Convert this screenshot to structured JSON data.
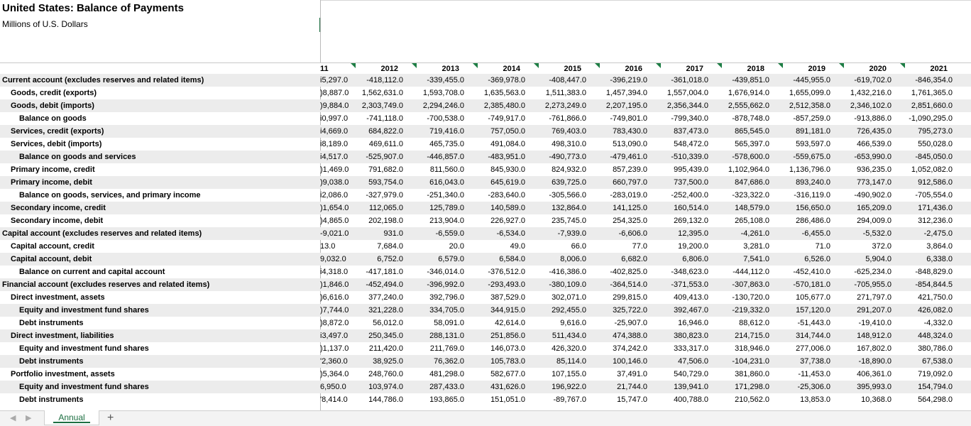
{
  "sheet": {
    "title": "United States: Balance of Payments",
    "subtitle": "Millions of U.S. Dollars"
  },
  "years": [
    {
      "label": "11",
      "partial": true
    },
    {
      "label": "2012"
    },
    {
      "label": "2013"
    },
    {
      "label": "2014"
    },
    {
      "label": "2015"
    },
    {
      "label": "2016"
    },
    {
      "label": "2017"
    },
    {
      "label": "2018"
    },
    {
      "label": "2019"
    },
    {
      "label": "2020"
    },
    {
      "label": "2021"
    }
  ],
  "rows": [
    {
      "label": "Current account (excludes reserves and related items)",
      "indent": 0,
      "values": [
        "i5,297.0",
        "-418,112.0",
        "-339,455.0",
        "-369,978.0",
        "-408,447.0",
        "-396,219.0",
        "-361,018.0",
        "-439,851.0",
        "-445,955.0",
        "-619,702.0",
        "-846,354.0"
      ]
    },
    {
      "label": "Goods, credit (exports)",
      "indent": 1,
      "values": [
        ")8,887.0",
        "1,562,631.0",
        "1,593,708.0",
        "1,635,563.0",
        "1,511,383.0",
        "1,457,394.0",
        "1,557,004.0",
        "1,676,914.0",
        "1,655,099.0",
        "1,432,216.0",
        "1,761,365.0"
      ]
    },
    {
      "label": "Goods, debit (imports)",
      "indent": 1,
      "values": [
        ")9,884.0",
        "2,303,749.0",
        "2,294,246.0",
        "2,385,480.0",
        "2,273,249.0",
        "2,207,195.0",
        "2,356,344.0",
        "2,555,662.0",
        "2,512,358.0",
        "2,346,102.0",
        "2,851,660.0"
      ]
    },
    {
      "label": "Balance on goods",
      "indent": 2,
      "values": [
        "i0,997.0",
        "-741,118.0",
        "-700,538.0",
        "-749,917.0",
        "-761,866.0",
        "-749,801.0",
        "-799,340.0",
        "-878,748.0",
        "-857,259.0",
        "-913,886.0",
        "-1,090,295.0"
      ]
    },
    {
      "label": "Services, credit (exports)",
      "indent": 1,
      "values": [
        "i4,669.0",
        "684,822.0",
        "719,416.0",
        "757,050.0",
        "769,403.0",
        "783,430.0",
        "837,473.0",
        "865,545.0",
        "891,181.0",
        "726,435.0",
        "795,273.0"
      ]
    },
    {
      "label": "Services, debit (imports)",
      "indent": 1,
      "values": [
        "i8,189.0",
        "469,611.0",
        "465,735.0",
        "491,084.0",
        "498,310.0",
        "513,090.0",
        "548,472.0",
        "565,397.0",
        "593,597.0",
        "466,539.0",
        "550,028.0"
      ]
    },
    {
      "label": "Balance on goods and services",
      "indent": 2,
      "values": [
        "i4,517.0",
        "-525,907.0",
        "-446,857.0",
        "-483,951.0",
        "-490,773.0",
        "-479,461.0",
        "-510,339.0",
        "-578,600.0",
        "-559,675.0",
        "-653,990.0",
        "-845,050.0"
      ]
    },
    {
      "label": "Primary income, credit",
      "indent": 1,
      "values": [
        ")1,469.0",
        "791,682.0",
        "811,560.0",
        "845,930.0",
        "824,932.0",
        "857,239.0",
        "995,439.0",
        "1,102,964.0",
        "1,136,796.0",
        "936,235.0",
        "1,052,082.0"
      ]
    },
    {
      "label": "Primary income, debit",
      "indent": 1,
      "values": [
        ")9,038.0",
        "593,754.0",
        "616,043.0",
        "645,619.0",
        "639,725.0",
        "660,797.0",
        "737,500.0",
        "847,686.0",
        "893,240.0",
        "773,147.0",
        "912,586.0"
      ]
    },
    {
      "label": "Balance on goods, services, and primary income",
      "indent": 2,
      "values": [
        "i2,086.0",
        "-327,979.0",
        "-251,340.0",
        "-283,640.0",
        "-305,566.0",
        "-283,019.0",
        "-252,400.0",
        "-323,322.0",
        "-316,119.0",
        "-490,902.0",
        "-705,554.0"
      ]
    },
    {
      "label": "Secondary income, credit",
      "indent": 1,
      "values": [
        ")1,654.0",
        "112,065.0",
        "125,789.0",
        "140,589.0",
        "132,864.0",
        "141,125.0",
        "160,514.0",
        "148,579.0",
        "156,650.0",
        "165,209.0",
        "171,436.0"
      ]
    },
    {
      "label": "Secondary income, debit",
      "indent": 1,
      "values": [
        ")4,865.0",
        "202,198.0",
        "213,904.0",
        "226,927.0",
        "235,745.0",
        "254,325.0",
        "269,132.0",
        "265,108.0",
        "286,486.0",
        "294,009.0",
        "312,236.0"
      ]
    },
    {
      "label": "Capital account (excludes reserves and related items)",
      "indent": 0,
      "values": [
        "-9,021.0",
        "931.0",
        "-6,559.0",
        "-6,534.0",
        "-7,939.0",
        "-6,606.0",
        "12,395.0",
        "-4,261.0",
        "-6,455.0",
        "-5,532.0",
        "-2,475.0"
      ]
    },
    {
      "label": "Capital account, credit",
      "indent": 1,
      "values": [
        "13.0",
        "7,684.0",
        "20.0",
        "49.0",
        "66.0",
        "77.0",
        "19,200.0",
        "3,281.0",
        "71.0",
        "372.0",
        "3,864.0"
      ]
    },
    {
      "label": "Capital account, debit",
      "indent": 1,
      "values": [
        "9,032.0",
        "6,752.0",
        "6,579.0",
        "6,584.0",
        "8,006.0",
        "6,682.0",
        "6,806.0",
        "7,541.0",
        "6,526.0",
        "5,904.0",
        "6,338.0"
      ]
    },
    {
      "label": "Balance on current and capital account",
      "indent": 2,
      "values": [
        "i4,318.0",
        "-417,181.0",
        "-346,014.0",
        "-376,512.0",
        "-416,386.0",
        "-402,825.0",
        "-348,623.0",
        "-444,112.0",
        "-452,410.0",
        "-625,234.0",
        "-848,829.0"
      ]
    },
    {
      "label": "Financial account (excludes reserves and related items)",
      "indent": 0,
      "values": [
        ")1,846.0",
        "-452,494.0",
        "-396,992.0",
        "-293,493.0",
        "-380,109.0",
        "-364,514.0",
        "-371,553.0",
        "-307,863.0",
        "-570,181.0",
        "-705,955.0",
        "-854,844.5"
      ]
    },
    {
      "label": "Direct investment, assets",
      "indent": 1,
      "values": [
        ")6,616.0",
        "377,240.0",
        "392,796.0",
        "387,529.0",
        "302,071.0",
        "299,815.0",
        "409,413.0",
        "-130,720.0",
        "105,677.0",
        "271,797.0",
        "421,750.0"
      ]
    },
    {
      "label": "Equity and investment fund shares",
      "indent": 2,
      "values": [
        ")7,744.0",
        "321,228.0",
        "334,705.0",
        "344,915.0",
        "292,455.0",
        "325,722.0",
        "392,467.0",
        "-219,332.0",
        "157,120.0",
        "291,207.0",
        "426,082.0"
      ]
    },
    {
      "label": "Debt instruments",
      "indent": 2,
      "values": [
        ")8,872.0",
        "56,012.0",
        "58,091.0",
        "42,614.0",
        "9,616.0",
        "-25,907.0",
        "16,946.0",
        "88,612.0",
        "-51,443.0",
        "-19,410.0",
        "-4,332.0"
      ]
    },
    {
      "label": "Direct investment, liabilities",
      "indent": 1,
      "values": [
        "i3,497.0",
        "250,345.0",
        "288,131.0",
        "251,856.0",
        "511,434.0",
        "474,388.0",
        "380,823.0",
        "214,715.0",
        "314,744.0",
        "148,912.0",
        "448,324.0"
      ]
    },
    {
      "label": "Equity and investment fund shares",
      "indent": 2,
      "values": [
        ")1,137.0",
        "211,420.0",
        "211,769.0",
        "146,073.0",
        "426,320.0",
        "374,242.0",
        "333,317.0",
        "318,946.0",
        "277,006.0",
        "167,802.0",
        "380,786.0"
      ]
    },
    {
      "label": "Debt instruments",
      "indent": 2,
      "values": [
        "'2,360.0",
        "38,925.0",
        "76,362.0",
        "105,783.0",
        "85,114.0",
        "100,146.0",
        "47,506.0",
        "-104,231.0",
        "37,738.0",
        "-18,890.0",
        "67,538.0"
      ]
    },
    {
      "label": "Portfolio investment, assets",
      "indent": 1,
      "values": [
        ")5,364.0",
        "248,760.0",
        "481,298.0",
        "582,677.0",
        "107,155.0",
        "37,491.0",
        "540,729.0",
        "381,860.0",
        "-11,453.0",
        "406,361.0",
        "719,092.0"
      ]
    },
    {
      "label": "Equity and investment fund shares",
      "indent": 2,
      "values": [
        "6,950.0",
        "103,974.0",
        "287,433.0",
        "431,626.0",
        "196,922.0",
        "21,744.0",
        "139,941.0",
        "171,298.0",
        "-25,306.0",
        "395,993.0",
        "154,794.0"
      ]
    },
    {
      "label": "Debt instruments",
      "indent": 2,
      "values": [
        "'8,414.0",
        "144,786.0",
        "193,865.0",
        "151,051.0",
        "-89,767.0",
        "15,747.0",
        "400,788.0",
        "210,562.0",
        "13,853.0",
        "10,368.0",
        "564,298.0"
      ]
    }
  ],
  "tabs": {
    "active": "Annual",
    "add": "+",
    "prev": "◀",
    "next": "▶"
  }
}
